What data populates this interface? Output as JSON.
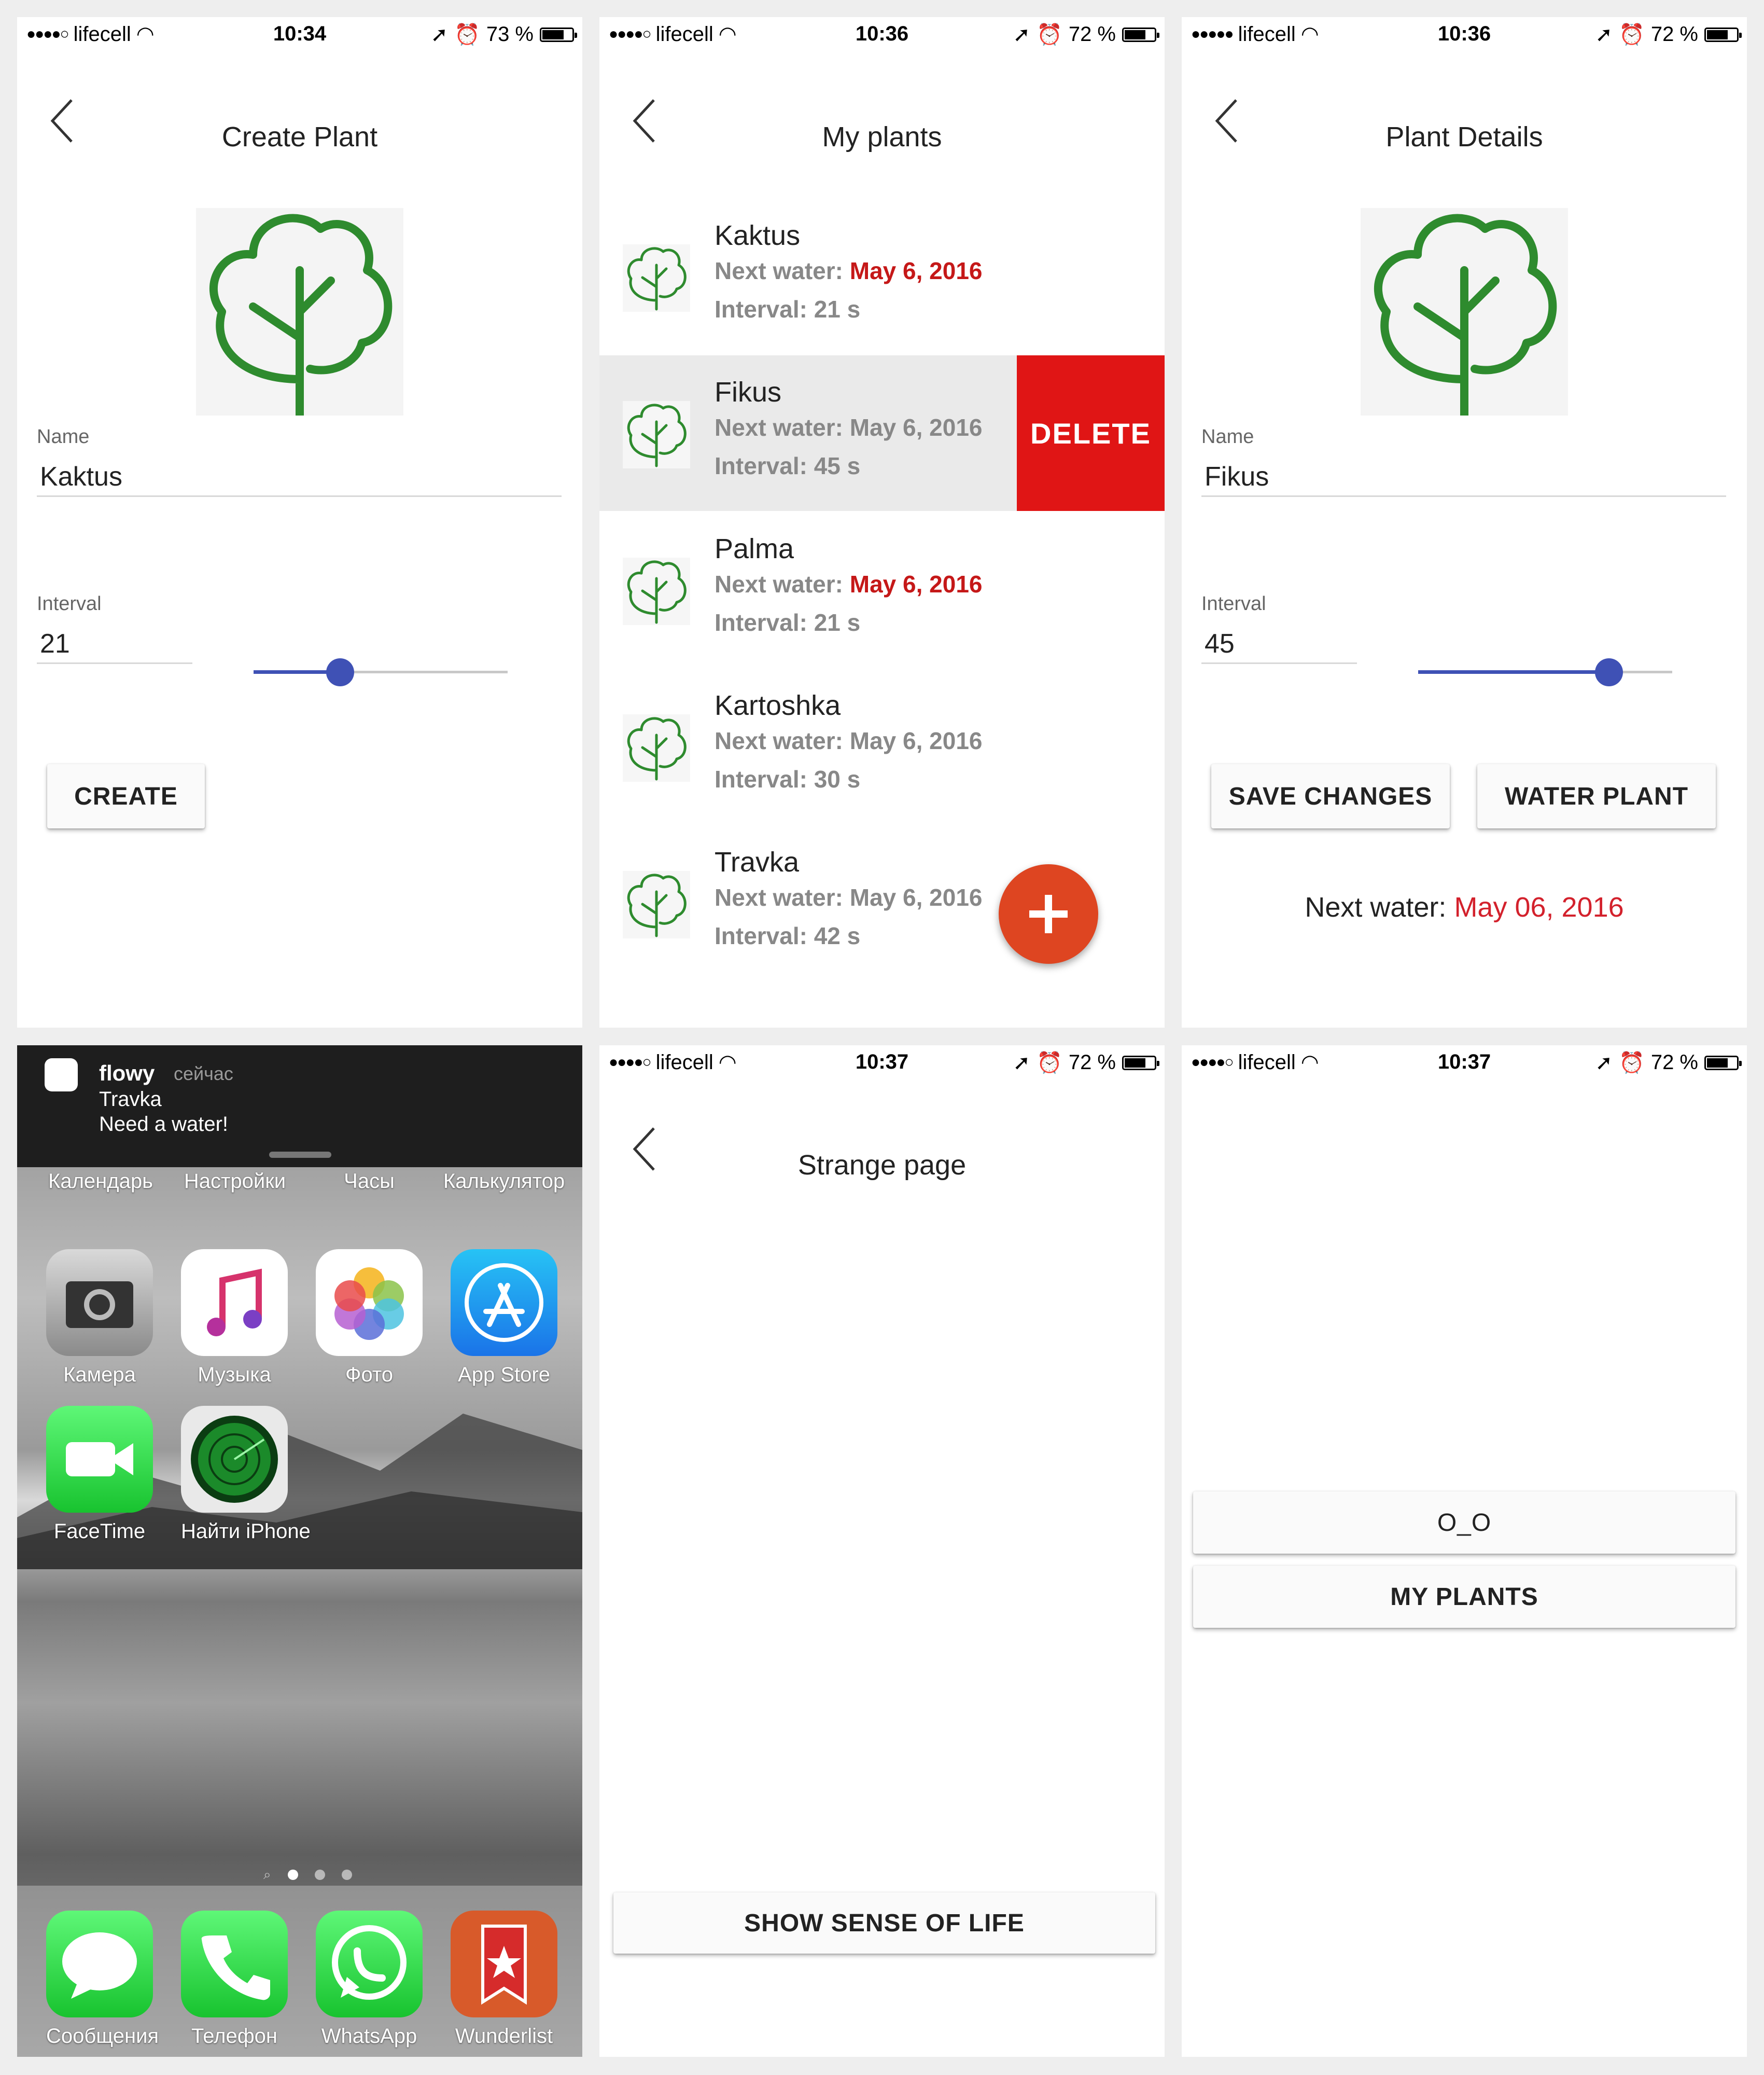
{
  "screen1": {
    "status": {
      "carrier": "lifecell",
      "time": "10:34",
      "battery": "73 %",
      "battery_level": 0.73
    },
    "title": "Create Plant",
    "name_label": "Name",
    "name_value": "Kaktus",
    "interval_label": "Interval",
    "interval_value": "21",
    "slider_fraction": 0.34,
    "create_label": "CREATE"
  },
  "screen2": {
    "status": {
      "carrier": "lifecell",
      "time": "10:36",
      "battery": "72 %",
      "battery_level": 0.72
    },
    "title": "My plants",
    "next_prefix": "Next water:",
    "plants": [
      {
        "name": "Kaktus",
        "next": "May 6, 2016",
        "overdue": true,
        "interval": "Interval: 21 s"
      },
      {
        "name": "Fikus",
        "next": "May 6, 2016",
        "overdue": false,
        "interval": "Interval: 45 s"
      },
      {
        "name": "Palma",
        "next": "May 6, 2016",
        "overdue": true,
        "interval": "Interval: 21 s"
      },
      {
        "name": "Kartoshka",
        "next": "May 6, 2016",
        "overdue": false,
        "interval": "Interval: 30 s"
      },
      {
        "name": "Travka",
        "next": "May 6, 2016",
        "overdue": false,
        "interval": "Interval: 42 s"
      }
    ],
    "delete_label": "DELETE",
    "fab_icon": "plus-icon"
  },
  "screen3": {
    "status": {
      "carrier": "lifecell",
      "time": "10:36",
      "battery": "72 %",
      "battery_level": 0.72
    },
    "title": "Plant Details",
    "name_label": "Name",
    "name_value": "Fikus",
    "interval_label": "Interval",
    "interval_value": "45",
    "slider_fraction": 0.75,
    "save_label": "SAVE CHANGES",
    "water_label": "WATER PLANT",
    "next_water_label": "Next water:",
    "next_water_date": "May 06, 2016"
  },
  "screen4": {
    "notification": {
      "app": "flowy",
      "time": "сейчас",
      "title": "Travka",
      "body": "Need a water!"
    },
    "partial_apps": [
      "Календарь",
      "Настройки",
      "Часы",
      "Калькулятор"
    ],
    "apps": [
      "Камера",
      "Музыка",
      "Фото",
      "App Store",
      "FaceTime",
      "Найти iPhone"
    ],
    "dock": [
      "Сообщения",
      "Телефон",
      "WhatsApp",
      "Wunderlist"
    ]
  },
  "screen5": {
    "status": {
      "carrier": "lifecell",
      "time": "10:37",
      "battery": "72 %",
      "battery_level": 0.72
    },
    "title": "Strange page",
    "button_label": "SHOW SENSE OF LIFE"
  },
  "screen6": {
    "status": {
      "carrier": "lifecell",
      "time": "10:37",
      "battery": "72 %",
      "battery_level": 0.72
    },
    "button1_label": "O_O",
    "button2_label": "MY PLANTS"
  },
  "colors": {
    "accent": "#3f51b5",
    "danger": "#e01515",
    "fab": "#de4521",
    "plant_green": "#2e8b2e",
    "overdue_red": "#c51818"
  }
}
